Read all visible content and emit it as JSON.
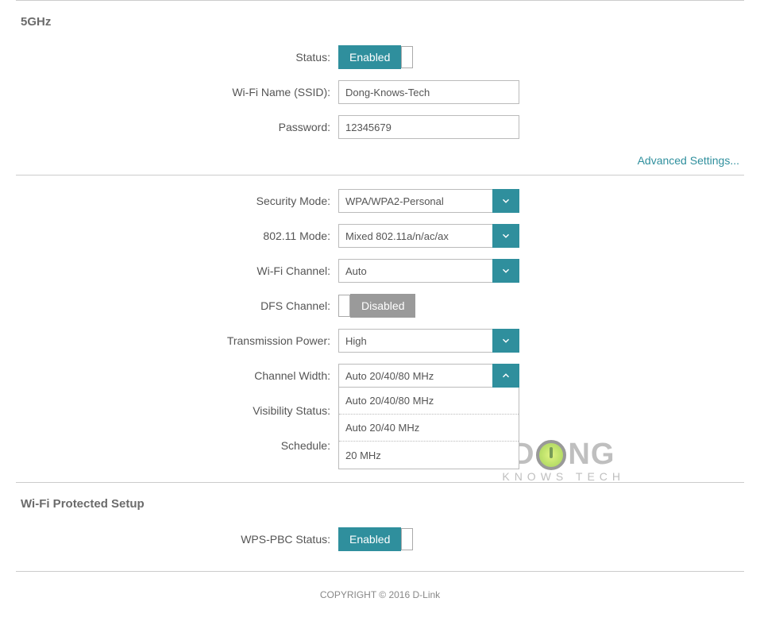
{
  "sections": {
    "five_ghz": {
      "title": "5GHz",
      "status_label": "Status:",
      "status_value": "Enabled",
      "ssid_label": "Wi-Fi Name (SSID):",
      "ssid_value": "Dong-Knows-Tech",
      "password_label": "Password:",
      "password_value": "12345679"
    },
    "adv_link": "Advanced Settings...",
    "advanced": {
      "security_mode_label": "Security Mode:",
      "security_mode_value": "WPA/WPA2-Personal",
      "mode_80211_label": "802.11 Mode:",
      "mode_80211_value": "Mixed 802.11a/n/ac/ax",
      "channel_label": "Wi-Fi Channel:",
      "channel_value": "Auto",
      "dfs_label": "DFS Channel:",
      "dfs_value": "Disabled",
      "tx_power_label": "Transmission Power:",
      "tx_power_value": "High",
      "ch_width_label": "Channel Width:",
      "ch_width_value": "Auto 20/40/80 MHz",
      "ch_width_options": [
        "Auto 20/40/80 MHz",
        "Auto 20/40 MHz",
        "20 MHz"
      ],
      "visibility_label": "Visibility Status:",
      "schedule_label": "Schedule:"
    },
    "wps": {
      "title": "Wi-Fi Protected Setup",
      "pbc_label": "WPS-PBC Status:",
      "pbc_value": "Enabled"
    }
  },
  "footer": "COPYRIGHT © 2016 D-Link",
  "watermark": {
    "top1": "D",
    "top2": "NG",
    "sub": "KNOWS TECH"
  }
}
